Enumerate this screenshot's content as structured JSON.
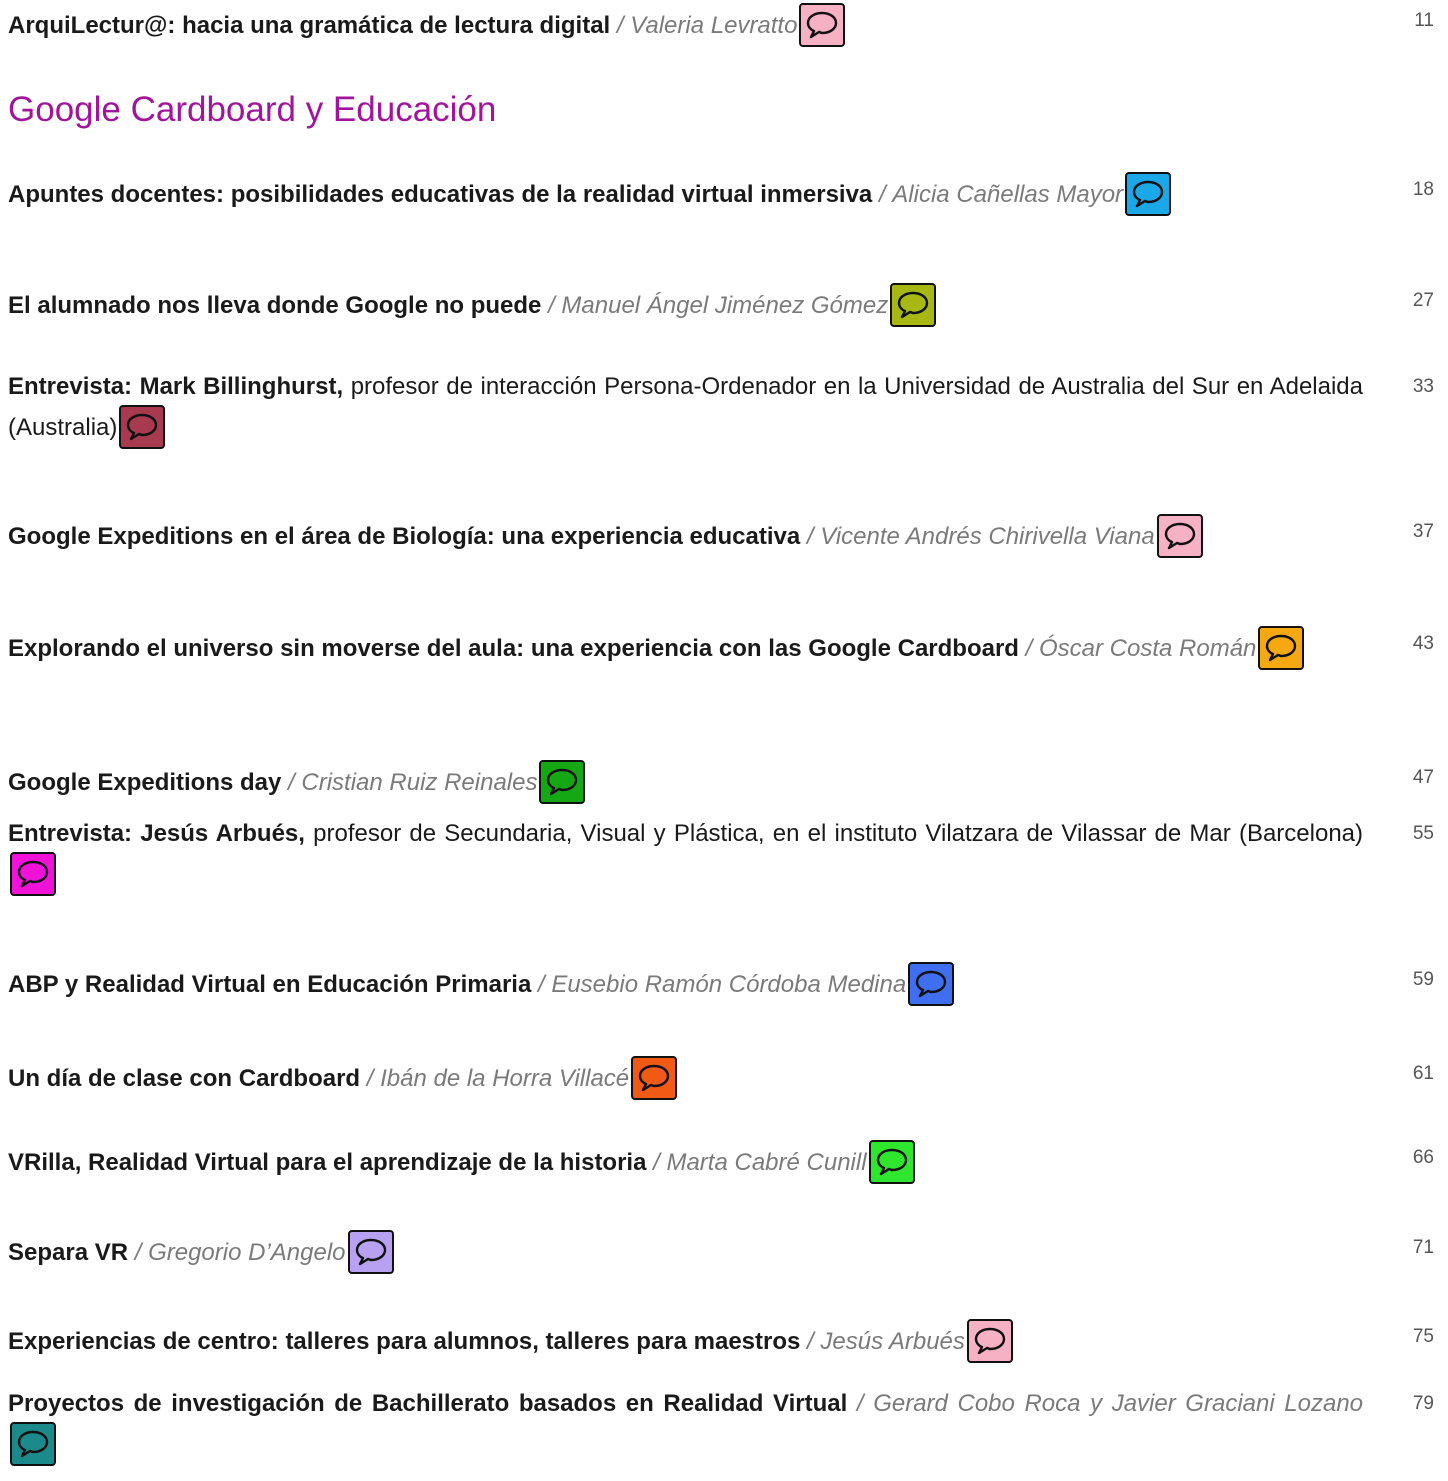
{
  "section_title": "Google Cardboard y Educación",
  "separator": "/",
  "entries": [
    {
      "title": "ArquiLectur@: hacia una gramática de lectura digital",
      "desc": "",
      "author": "Valeria Levratto",
      "page": "11",
      "icon_color": "#f7b1c4"
    },
    {
      "title": "Apuntes docentes: posibilidades educativas de la realidad virtual inmersiva",
      "desc": "",
      "author": "Alicia Cañellas Mayor",
      "page": "18",
      "icon_color": "#1aa8e8"
    },
    {
      "title": "El alumnado nos lleva donde Google no puede",
      "desc": "",
      "author": "Manuel Ángel Jiménez Gómez",
      "page": "27",
      "icon_color": "#a8b812"
    },
    {
      "title": "Entrevista: Mark Billinghurst,",
      "desc": "profesor de interacción Persona-Ordenador en la Universidad de Australia del Sur en Adelaida (Australia)",
      "author": "",
      "page": "33",
      "icon_color": "#a83a4f"
    },
    {
      "title": "Google Expeditions en el área de Biología: una experiencia educativa",
      "desc": "",
      "author": "Vicente Andrés Chirivella Viana",
      "page": "37",
      "icon_color": "#f7b1c4"
    },
    {
      "title": "Explorando el universo sin moverse del aula: una experiencia con las Google Cardboard",
      "desc": "",
      "author": "Óscar Costa Román",
      "page": "43",
      "icon_color": "#f5a80f"
    },
    {
      "title": "Google Expeditions day",
      "desc": "",
      "author": "Cristian Ruiz Reinales",
      "page": "47",
      "icon_color": "#14a814"
    },
    {
      "title": "Entrevista: Jesús Arbués,",
      "desc": "profesor de Secundaria, Visual y Plástica, en el instituto Vilatzara de Vilassar de Mar (Barcelona)",
      "author": "",
      "page": "55",
      "icon_color": "#f012d8"
    },
    {
      "title": "ABP y Realidad Virtual en Educación Primaria",
      "desc": "",
      "author": "Eusebio Ramón Córdoba Medina",
      "page": "59",
      "icon_color": "#3f6ef0"
    },
    {
      "title": "Un día de clase con Cardboard",
      "desc": "",
      "author": "Ibán de la Horra Villacé",
      "page": "61",
      "icon_color": "#f05a14"
    },
    {
      "title": "VRilla, Realidad Virtual para el aprendizaje de la historia",
      "desc": "",
      "author": "Marta Cabré Cunill",
      "page": "66",
      "icon_color": "#2ee62e"
    },
    {
      "title": "Separa VR",
      "desc": "",
      "author": "Gregorio D’Angelo",
      "page": "71",
      "icon_color": "#b8a1f0"
    },
    {
      "title": "Experiencias de centro: talleres para alumnos, talleres para maestros",
      "desc": "",
      "author": "Jesús Arbués",
      "page": "75",
      "icon_color": "#f7b1c4"
    },
    {
      "title": "Proyectos de investigación de Bachillerato basados en Realidad Virtual",
      "desc": "",
      "author": "Gerard Cobo Roca y Javier Graciani Lozano",
      "page": "79",
      "icon_color": "#1a8a8a"
    }
  ]
}
